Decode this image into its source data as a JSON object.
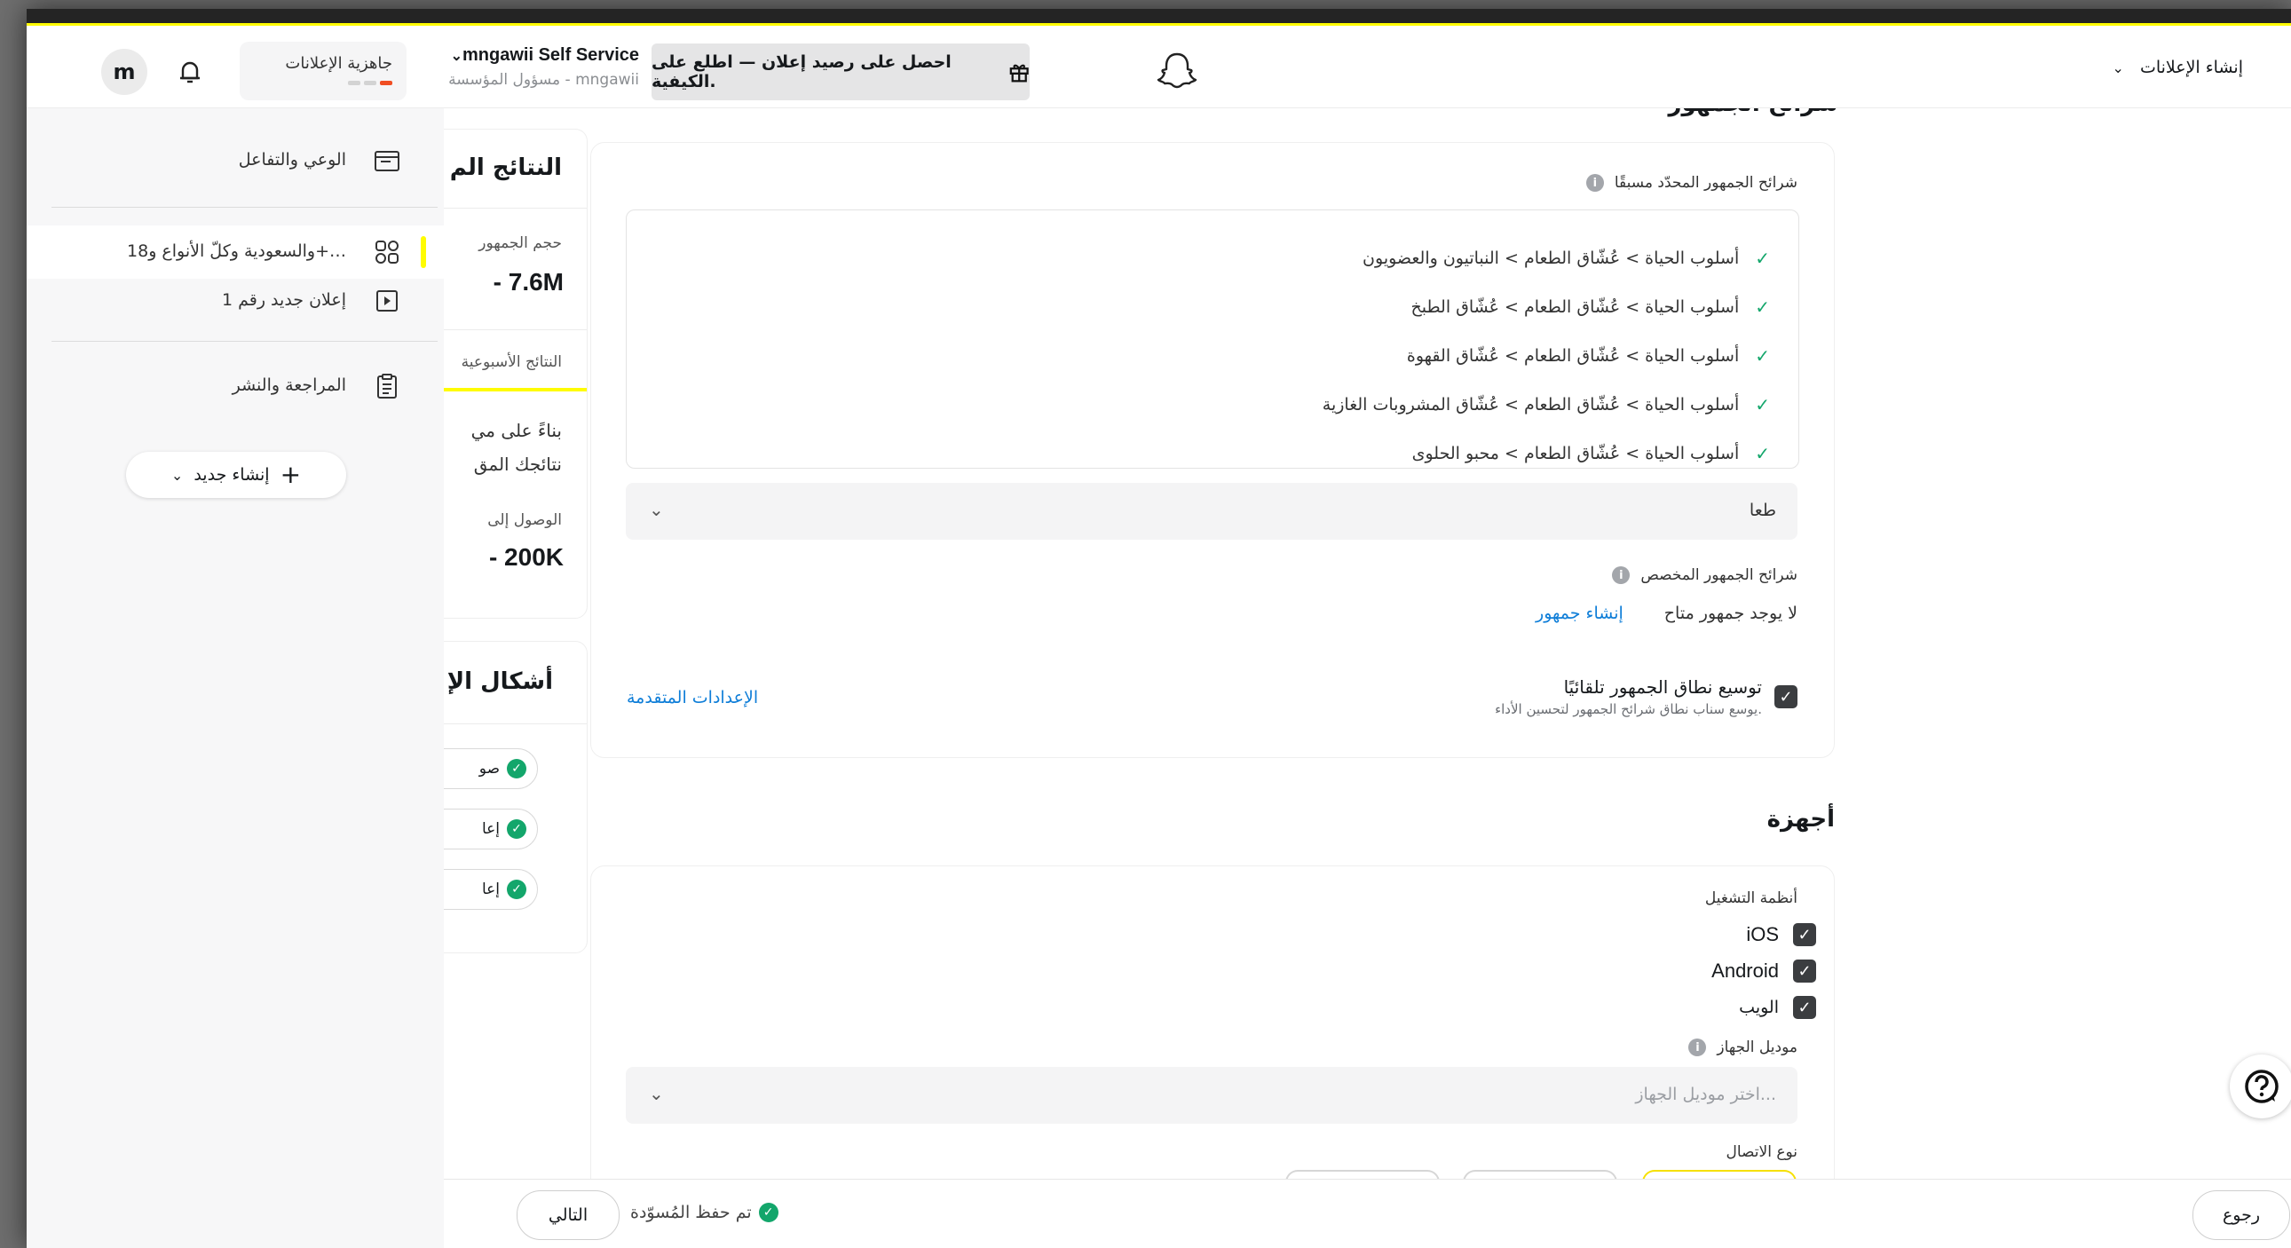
{
  "header": {
    "avatar_letter": "m",
    "readiness_label": "جاهزية الإعلانات",
    "account_name": "mngawii Self Service",
    "account_role": "مسؤول المؤسسة - mngawii",
    "promo_text": "احصل على رصيد إعلان — اطلع على الكيفية.",
    "create_ads_label": "إنشاء الإعلانات"
  },
  "sidebar": {
    "items": [
      {
        "label": "الوعي والتفاعل",
        "icon": "folder-icon"
      },
      {
        "label": "والسعودية وكلّ الأنواع و18+…",
        "icon": "audience-icon"
      },
      {
        "label": "إعلان جديد رقم 1",
        "icon": "ad-icon"
      },
      {
        "label": "المراجعة والنشر",
        "icon": "clipboard-icon"
      }
    ],
    "create_new_label": "إنشاء جديد"
  },
  "results": {
    "title": "النتائج الم",
    "audience_size_label": "حجم الجمهور",
    "audience_size_value": "- 7.6M",
    "weekly_label": "النتائج الأسبوعية",
    "body_line1": "بناءً على مي",
    "body_line2": "نتائجك المق",
    "reach_label": "الوصول إلى",
    "reach_value": "- 200K"
  },
  "formats": {
    "title": "أشكال الإ",
    "items": [
      "صو",
      "إعا",
      "إعا"
    ]
  },
  "audience": {
    "section_title": "شرائح الجمهور",
    "predefined_label": "شرائح الجمهور المحدّد مسبقًا",
    "predefined_items": [
      "أسلوب الحياة > عُشّاق الطعام > النباتيون والعضويون",
      "أسلوب الحياة > عُشّاق الطعام > عُشّاق الطبخ",
      "أسلوب الحياة > عُشّاق الطعام > عُشّاق القهوة",
      "أسلوب الحياة > عُشّاق الطعام > عُشّاق المشروبات الغازية",
      "أسلوب الحياة > عُشّاق الطعام > محبو الحلوى"
    ],
    "search_value": "طعا",
    "custom_label": "شرائح الجمهور المخصص",
    "no_audience_text": "لا يوجد جمهور متاح",
    "create_audience_link": "إنشاء جمهور",
    "expand_title": "توسيع نطاق الجمهور تلقائيًا",
    "expand_desc": "يوسع سناب نطاق شرائح الجمهور لتحسين الأداء.",
    "advanced_link": "الإعدادات المتقدمة"
  },
  "devices": {
    "section_title": "أجهزة",
    "os_label": "أنظمة التشغيل",
    "os_options": [
      "iOS",
      "Android",
      "الويب"
    ],
    "model_label": "موديل الجهاز",
    "model_placeholder": "اختر موديل الجهاز...",
    "connection_label": "نوع الاتصال"
  },
  "footer": {
    "back_label": "رجوع",
    "saved_text": "تم حفظ المُسوّدة",
    "next_label": "التالي"
  },
  "colors": {
    "brand_yellow": "#fffc00",
    "success_green": "#13a66b",
    "link_blue": "#0f7ed8"
  }
}
